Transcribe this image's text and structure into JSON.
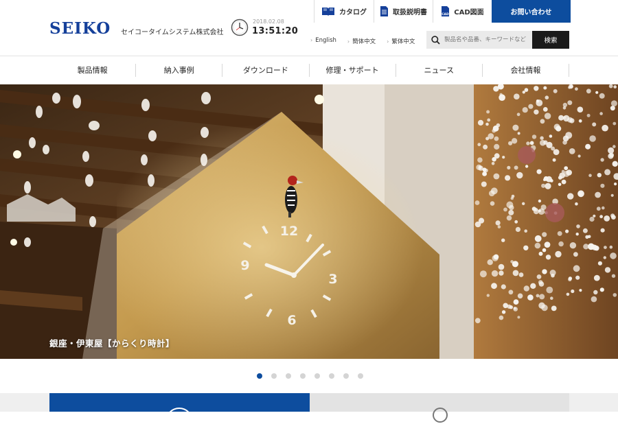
{
  "header": {
    "logo": "SEIKO",
    "company": "セイコータイムシステム株式会社",
    "clock": {
      "date": "2018.02.08",
      "time": "13:51:20"
    },
    "top_buttons": [
      {
        "label": "カタログ",
        "icon": "book-icon"
      },
      {
        "label": "取扱説明書",
        "icon": "document-icon"
      },
      {
        "label": "CAD図面",
        "icon": "cad-file-icon"
      },
      {
        "label": "お問い合わせ",
        "icon": ""
      }
    ],
    "languages": [
      "English",
      "簡体中文",
      "繁体中文"
    ],
    "search": {
      "placeholder": "製品名や品番、キーワードなど",
      "value": "",
      "button": "検索"
    }
  },
  "nav": [
    "製品情報",
    "納入事例",
    "ダウンロード",
    "修理・サポート",
    "ニュース",
    "会社情報"
  ],
  "hero": {
    "caption": "銀座・伊東屋【からくり時計】",
    "clock_numerals": [
      "12",
      "3",
      "6",
      "9"
    ]
  },
  "carousel": {
    "count": 8,
    "active_index": 0
  },
  "colors": {
    "brand_blue": "#15409a",
    "contact_blue": "#0d4d9e",
    "search_button": "#1a1a1a"
  }
}
